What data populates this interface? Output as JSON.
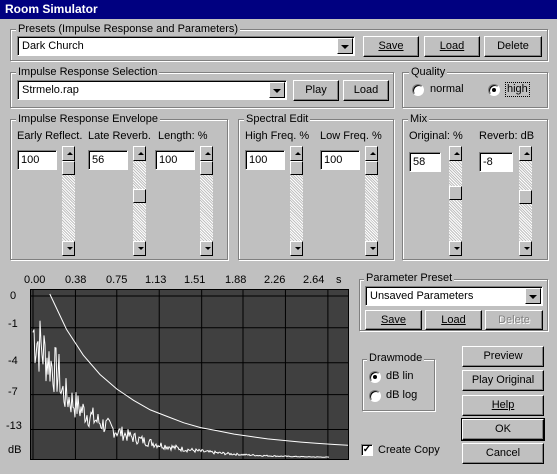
{
  "window": {
    "title": "Room Simulator"
  },
  "presets": {
    "group_label": "Presets (Impulse Response and Parameters)",
    "selected": "Dark Church",
    "save": "Save",
    "load": "Load",
    "delete": "Delete"
  },
  "ir": {
    "group_label": "Impulse Response Selection",
    "selected": "Strmelo.rap",
    "play": "Play",
    "load": "Load"
  },
  "quality": {
    "group_label": "Quality",
    "normal": "normal",
    "high": "high",
    "selected": "high"
  },
  "envelope": {
    "group_label": "Impulse Response Envelope",
    "early_label": "Early Reflect.",
    "early_value": "100",
    "late_label": "Late Reverb.",
    "late_value": "56",
    "length_label": "Length: %",
    "length_value": "100"
  },
  "spectral": {
    "group_label": "Spectral Edit",
    "high_label": "High Freq. %",
    "high_value": "100",
    "low_label": "Low Freq. %",
    "low_value": "100"
  },
  "mix": {
    "group_label": "Mix",
    "original_label": "Original: %",
    "original_value": "58",
    "reverb_label": "Reverb: dB",
    "reverb_value": "-8"
  },
  "param_preset": {
    "group_label": "Parameter Preset",
    "selected": "Unsaved Parameters",
    "save": "Save",
    "load": "Load",
    "delete": "Delete"
  },
  "drawmode": {
    "group_label": "Drawmode",
    "lin": "dB lin",
    "log": "dB log",
    "selected": "lin"
  },
  "buttons": {
    "preview": "Preview",
    "play_original": "Play Original",
    "help": "Help",
    "ok": "OK",
    "cancel": "Cancel"
  },
  "create_copy": {
    "label": "Create Copy",
    "checked": true
  },
  "chart_data": {
    "type": "line",
    "x_ticks": [
      "0.00",
      "0.38",
      "0.75",
      "1.13",
      "1.51",
      "1.88",
      "2.26",
      "2.64"
    ],
    "x_unit": "s",
    "y_ticks": [
      "0",
      "-1",
      "-4",
      "-7",
      "-13"
    ],
    "y_unit": "dB",
    "colors": {
      "background": "#404040",
      "grid": "#000000",
      "trace": "#ffffff"
    },
    "envelope_curve": {
      "x": [
        0.15,
        0.3,
        0.45,
        0.6,
        0.75,
        0.9,
        1.05,
        1.2,
        1.35,
        1.5,
        1.65,
        1.8,
        1.95,
        2.1,
        2.25,
        2.4,
        2.55,
        2.7,
        2.82
      ],
      "y": [
        1.0,
        0.78,
        0.62,
        0.5,
        0.41,
        0.34,
        0.28,
        0.24,
        0.2,
        0.17,
        0.15,
        0.13,
        0.115,
        0.1,
        0.09,
        0.08,
        0.072,
        0.065,
        0.06
      ]
    }
  }
}
